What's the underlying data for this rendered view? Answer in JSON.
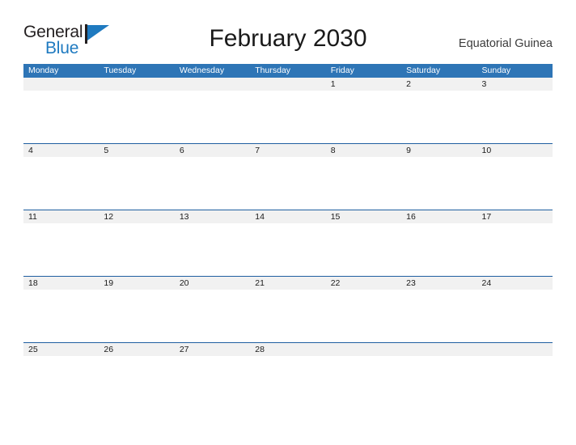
{
  "brand": {
    "name_part1": "General",
    "name_part2": "Blue",
    "flag_icon": "flag-triangle-icon",
    "primary_color": "#1f7ac0"
  },
  "header": {
    "title": "February 2030",
    "region": "Equatorial Guinea"
  },
  "calendar": {
    "header_bg_color": "#2e75b6",
    "row_line_color": "#1f5fa0",
    "date_strip_color": "#f1f1f1",
    "weekdays": [
      "Monday",
      "Tuesday",
      "Wednesday",
      "Thursday",
      "Friday",
      "Saturday",
      "Sunday"
    ],
    "weeks": [
      [
        "",
        "",
        "",
        "",
        "1",
        "2",
        "3"
      ],
      [
        "4",
        "5",
        "6",
        "7",
        "8",
        "9",
        "10"
      ],
      [
        "11",
        "12",
        "13",
        "14",
        "15",
        "16",
        "17"
      ],
      [
        "18",
        "19",
        "20",
        "21",
        "22",
        "23",
        "24"
      ],
      [
        "25",
        "26",
        "27",
        "28",
        "",
        "",
        ""
      ]
    ]
  }
}
